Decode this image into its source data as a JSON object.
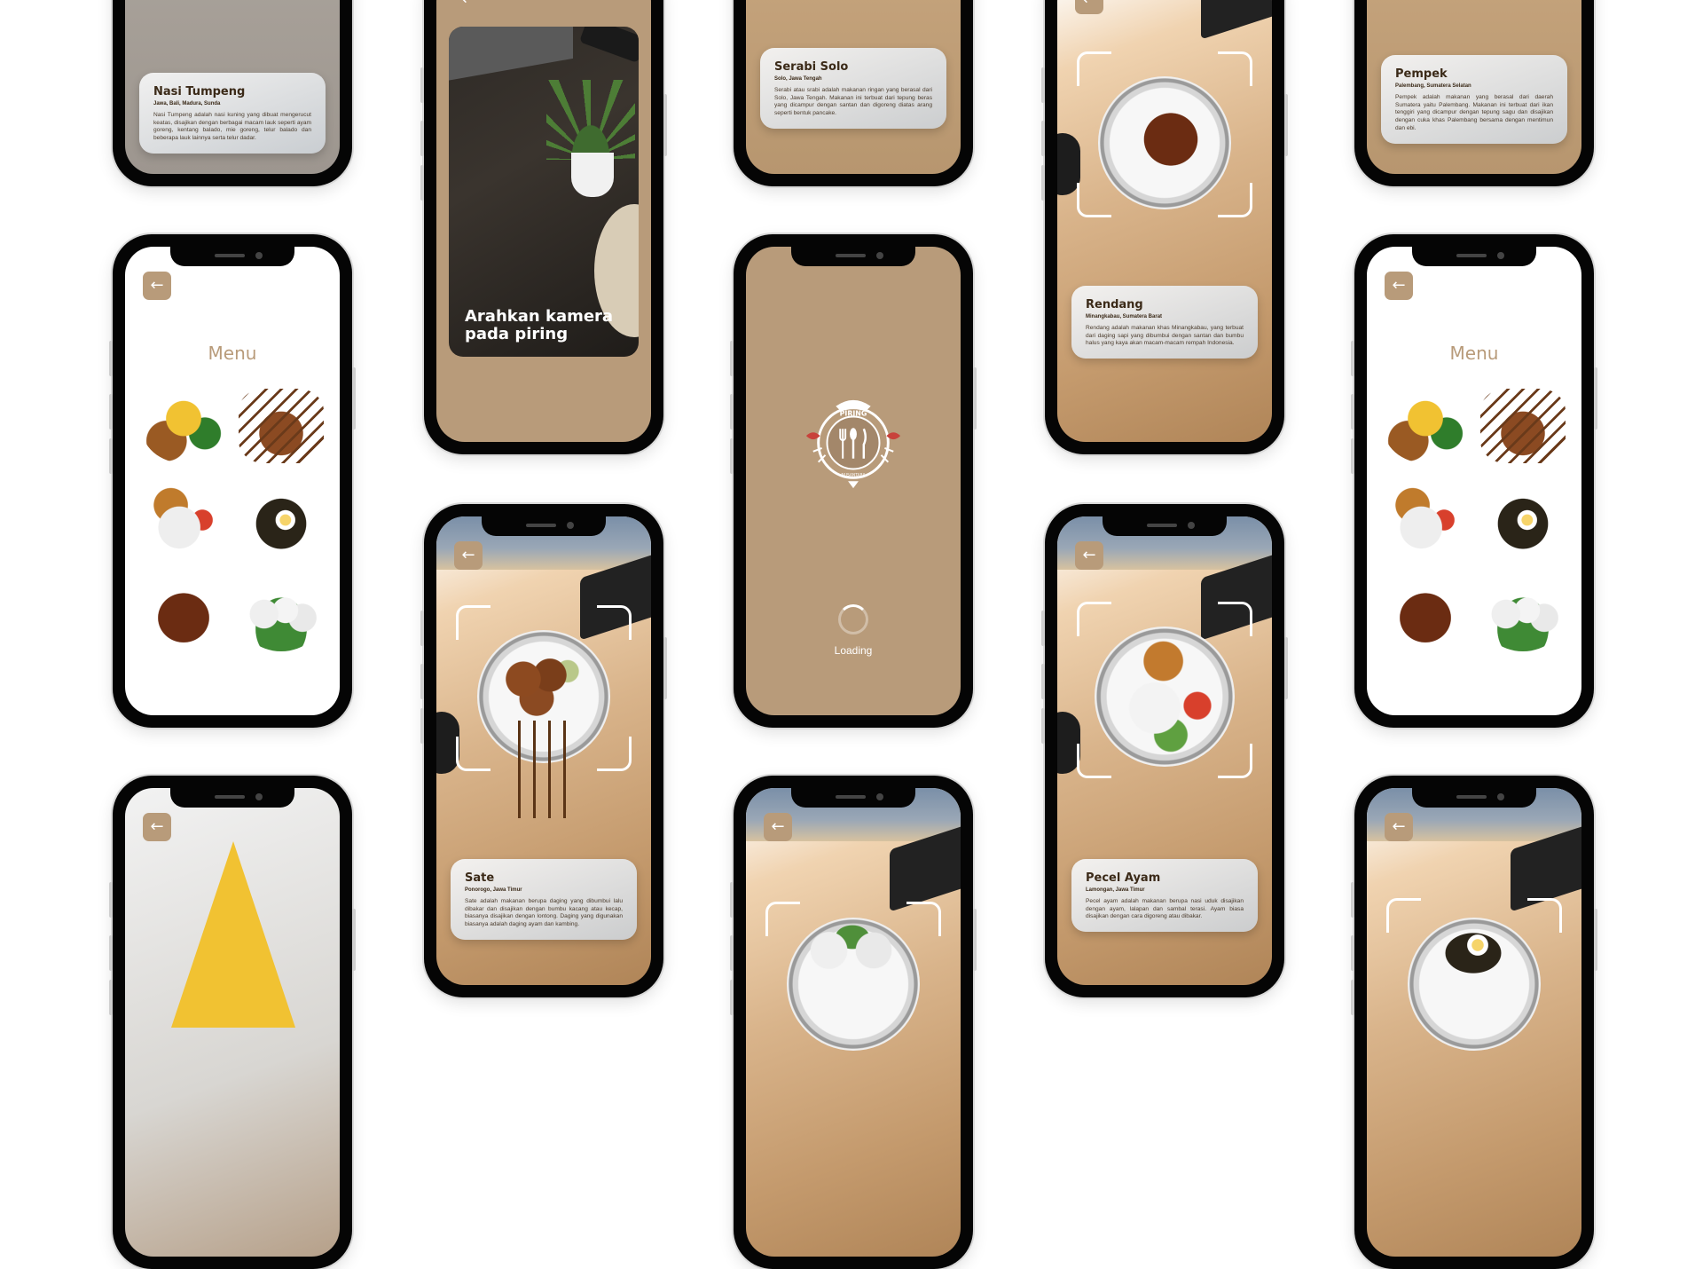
{
  "colors": {
    "accent": "#b89b7a",
    "card_text": "#3b2a18"
  },
  "icons": {
    "back": "←",
    "back_name": "arrow-left-icon"
  },
  "menu": {
    "title": "Menu"
  },
  "camera": {
    "hint_line1": "Arahkan kamera",
    "hint_line2": "pada piring"
  },
  "splash": {
    "loading": "Loading",
    "logo_top": "PIRING",
    "logo_bottom": "NUSANTARA"
  },
  "dishes": {
    "nasi_tumpeng": {
      "name": "Nasi Tumpeng",
      "origin": "Jawa, Bali, Madura, Sunda",
      "desc": "Nasi Tumpeng adalah nasi kuning yang dibuat mengerucut keatas, disajikan dengan berbagai macam lauk seperti ayam goreng, kentang balado, mie goreng, telur balado dan beberapa lauk lainnya serta telur dadar."
    },
    "serabi_solo": {
      "name": "Serabi Solo",
      "origin": "Solo, Jawa Tengah",
      "desc": "Serabi atau srabi adalah makanan ringan yang berasal dari Solo, Jawa Tengah. Makanan ini terbuat dari tepung beras yang dicampur dengan santan dan digoreng diatas arang seperti bentuk pancake."
    },
    "pempek": {
      "name": "Pempek",
      "origin": "Palembang, Sumatera Selatan",
      "desc": "Pempek adalah makanan yang berasal dari daerah Sumatera yaitu Palembang. Makanan ini terbuat dari ikan tenggiri yang dicampur dengan tepung sagu dan disajikan dengan cuka khas Palembang bersama dengan mentimun dan ebi."
    },
    "rendang": {
      "name": "Rendang",
      "origin": "Minangkabau, Sumatera Barat",
      "desc": "Rendang adalah makanan khas Minangkabau, yang terbuat dari daging sapi yang dibumbui dengan santan dan bumbu halus yang kaya akan macam-macam rempah Indonesia."
    },
    "sate": {
      "name": "Sate",
      "origin": "Ponorogo, Jawa Timur",
      "desc": "Sate adalah makanan berupa daging yang dibumbui lalu dibakar dan disajikan dengan bumbu kacang atau kecap, biasanya disajikan dengan lontong. Daging yang digunakan biasanya adalah daging ayam dan kambing."
    },
    "pecel_ayam": {
      "name": "Pecel Ayam",
      "origin": "Lamongan, Jawa Timur",
      "desc": "Pecel ayam adalah makanan berupa nasi uduk disajikan dengan ayam, lalapan dan sambal terasi. Ayam biasa disajikan dengan cara digoreng atau dibakar."
    }
  }
}
